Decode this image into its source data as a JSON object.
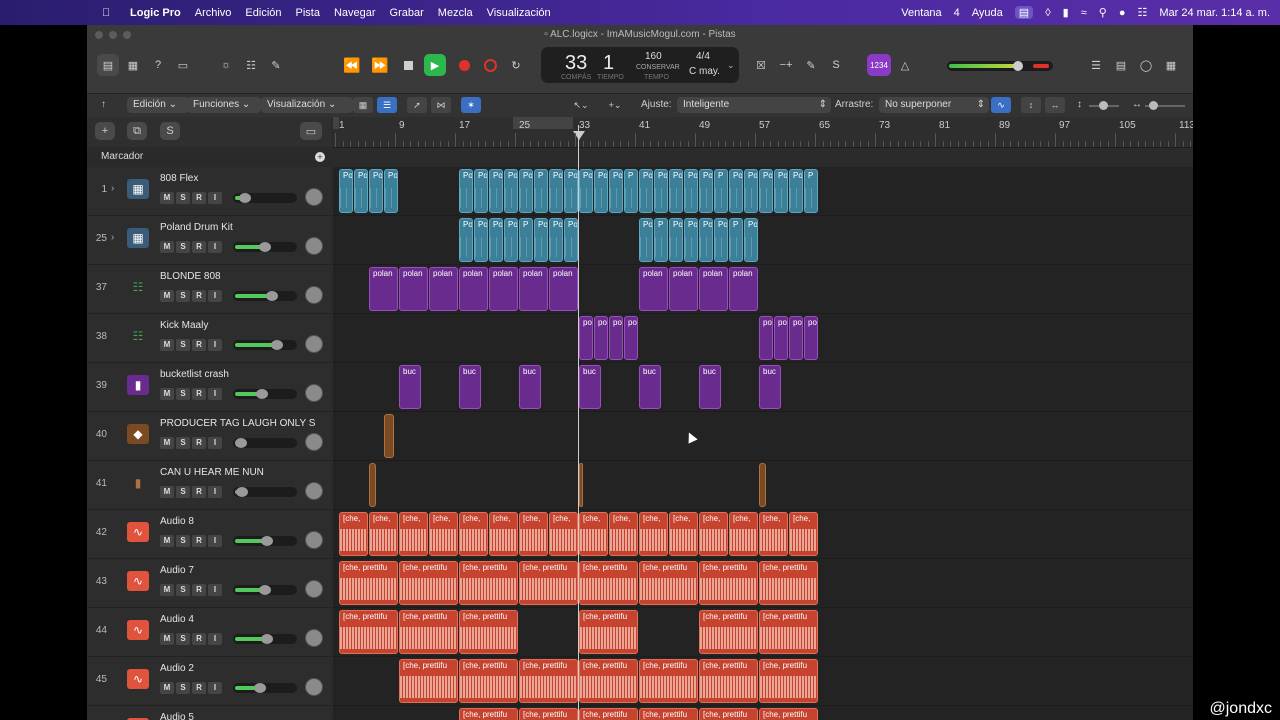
{
  "menubar": {
    "app": "Logic Pro",
    "items": [
      "Archivo",
      "Edición",
      "Pista",
      "Navegar",
      "Grabar",
      "Mezcla",
      "Visualización"
    ],
    "right_items": [
      "Ventana",
      "4",
      "Ayuda"
    ],
    "datetime": "Mar 24 mar.  1:14 a. m."
  },
  "window": {
    "title": "ALC.logicx - ImAMusicMogul.com - Pistas"
  },
  "lcd": {
    "bar": "33",
    "beat": "1",
    "bar_label": "COMPÁS",
    "beat_label": "TIEMPO",
    "tempo": "160",
    "tempo_mode": "CONSERVAR",
    "tempo_label": "TEMPO",
    "signature": "4/4",
    "key": "C may."
  },
  "count_in": "1234",
  "toolbar": {
    "edit": "Edición",
    "functions": "Funciones",
    "view": "Visualización",
    "snap_label": "Ajuste:",
    "snap_value": "Inteligente",
    "drag_label": "Arrastre:",
    "drag_value": "No superponer"
  },
  "marker_label": "Marcador",
  "add_track_label": "+",
  "solo_label": "S",
  "ruler_numbers": [
    "1",
    "9",
    "17",
    "25",
    "33",
    "41",
    "49",
    "57",
    "65",
    "73",
    "81",
    "89",
    "97",
    "105",
    "113"
  ],
  "tracks": [
    {
      "num": "1",
      "name": "808 Flex",
      "type": "drum",
      "level": 0.15
    },
    {
      "num": "25",
      "name": "Poland Drum Kit",
      "type": "drum",
      "level": 0.55
    },
    {
      "num": "37",
      "name": "BLONDE 808",
      "type": "synth",
      "level": 0.7
    },
    {
      "num": "38",
      "name": "Kick Maaly",
      "type": "synth",
      "level": 0.8
    },
    {
      "num": "39",
      "name": "bucketlist crash",
      "type": "sampler",
      "level": 0.5
    },
    {
      "num": "40",
      "name": "PRODUCER TAG LAUGH ONLY S",
      "type": "guitar",
      "level": 0.0
    },
    {
      "num": "41",
      "name": "CAN U HEAR ME NUN",
      "type": "bass",
      "level": 0.1
    },
    {
      "num": "42",
      "name": "Audio 8",
      "type": "audio",
      "level": 0.6
    },
    {
      "num": "43",
      "name": "Audio 7",
      "type": "audio",
      "level": 0.55
    },
    {
      "num": "44",
      "name": "Audio 4",
      "type": "audio",
      "level": 0.6
    },
    {
      "num": "45",
      "name": "Audio 2",
      "type": "audio",
      "level": 0.45
    },
    {
      "num": "",
      "name": "Audio 5",
      "type": "audio",
      "level": 0.4
    }
  ],
  "msri": [
    "M",
    "S",
    "R",
    "I"
  ],
  "region_labels": {
    "po": "Po",
    "p": "P",
    "polan": "polan",
    "po_lower": "po",
    "buc": "buc",
    "che_short": "[che,",
    "che_long": "[che, prettifu"
  },
  "watermark": "@jondxc",
  "colors": {
    "teal": "#3b7f99",
    "purple": "#6a2b8e",
    "red": "#c5432f",
    "play": "#2db84d",
    "record": "#e0312b",
    "accent": "#3a6fc4"
  }
}
